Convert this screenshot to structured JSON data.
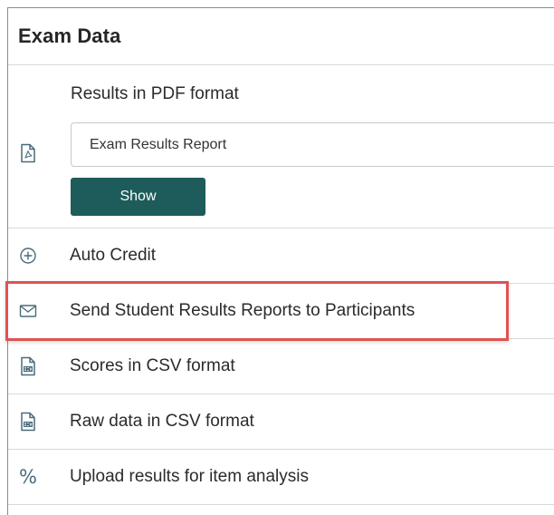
{
  "panel": {
    "title": "Exam Data"
  },
  "pdf_section": {
    "title": "Results in PDF format",
    "selected_report": "Exam Results Report",
    "show_label": "Show",
    "icon": "pdf-file-icon"
  },
  "menu": [
    {
      "label": "Auto Credit",
      "icon": "plus-circle-icon"
    },
    {
      "label": "Send Student Results Reports to Participants",
      "icon": "envelope-icon"
    },
    {
      "label": "Scores in CSV format",
      "icon": "csv-file-icon"
    },
    {
      "label": "Raw data in CSV format",
      "icon": "csv-file-icon"
    },
    {
      "label": "Upload results for item analysis",
      "icon": "percent-icon",
      "glyph": "%"
    }
  ],
  "colors": {
    "button": "#1d5c5a",
    "highlight": "#e05252",
    "icon": "#4a6b7a"
  }
}
